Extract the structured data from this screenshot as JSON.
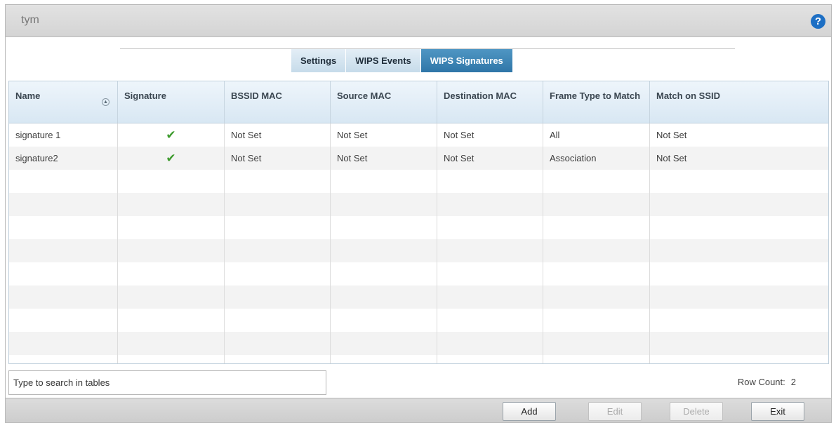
{
  "header": {
    "title": "tym",
    "help_glyph": "?"
  },
  "tabs": [
    {
      "label": "Settings",
      "active": false
    },
    {
      "label": "WIPS Events",
      "active": false
    },
    {
      "label": "WIPS Signatures",
      "active": true
    }
  ],
  "table": {
    "columns": [
      "Name",
      "Signature",
      "BSSID MAC",
      "Source MAC",
      "Destination MAC",
      "Frame Type to Match",
      "Match on SSID"
    ],
    "rows": [
      {
        "name": "signature 1",
        "signature": "✔",
        "bssid_mac": "Not Set",
        "source_mac": "Not Set",
        "destination_mac": "Not Set",
        "frame_type": "All",
        "match_ssid": "Not Set"
      },
      {
        "name": "signature2",
        "signature": "✔",
        "bssid_mac": "Not Set",
        "source_mac": "Not Set",
        "destination_mac": "Not Set",
        "frame_type": "Association",
        "match_ssid": "Not Set"
      }
    ],
    "sort_icon": "sort-circle-icon"
  },
  "search": {
    "placeholder": "Type to search in tables",
    "value": ""
  },
  "row_count": {
    "label": "Row Count:",
    "value": "2"
  },
  "footer": {
    "add": "Add",
    "edit": "Edit",
    "delete": "Delete",
    "exit": "Exit"
  },
  "colors": {
    "active_tab": "#2f76a8",
    "check": "#3c9a2c",
    "help": "#1d6fc4"
  }
}
